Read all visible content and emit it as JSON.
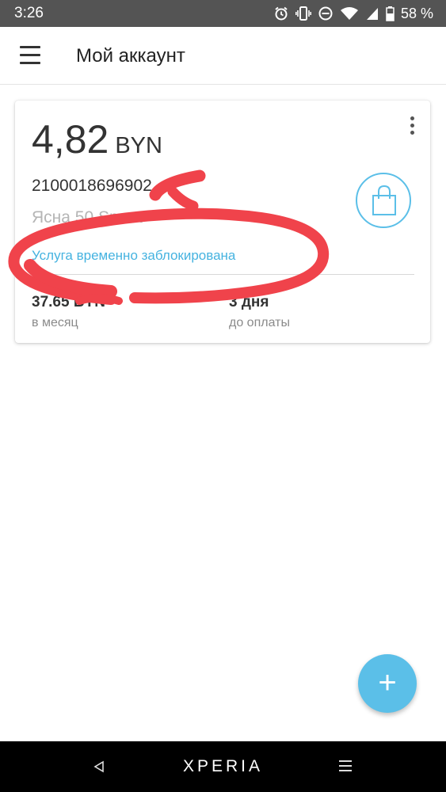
{
  "status_bar": {
    "time": "3:26",
    "battery": "58 %",
    "icons": [
      "alarm-icon",
      "vibrate-icon",
      "do-not-disturb-icon",
      "wifi-icon",
      "cell-signal-icon",
      "battery-icon"
    ]
  },
  "app_bar": {
    "title": "Мой аккаунт",
    "menu_icon": "hamburger-menu-icon"
  },
  "account_card": {
    "balance_amount": "4,82",
    "balance_currency": "BYN",
    "account_number": "2100018696902",
    "tariff": "Ясна 50 Smart",
    "service_status": "Услуга временно заблокирована",
    "monthly_fee": "37.65 BYN",
    "monthly_fee_label": "в месяц",
    "days_to_payment": "3 дня",
    "days_to_payment_label": "до оплаты",
    "shop_icon": "shopping-bag-icon",
    "more_icon": "more-vert-icon"
  },
  "fab": {
    "label": "+",
    "icon": "plus-icon"
  },
  "nav_bar": {
    "brand": "XPERIA",
    "back_icon": "back-triangle-icon",
    "menu_icon": "menu-lines-icon"
  },
  "colors": {
    "status_bar": "#545454",
    "accent": "#5bbfe8",
    "status_text": "#46b3e0",
    "scribble": "#f0434b",
    "nav_bar": "#000000"
  }
}
